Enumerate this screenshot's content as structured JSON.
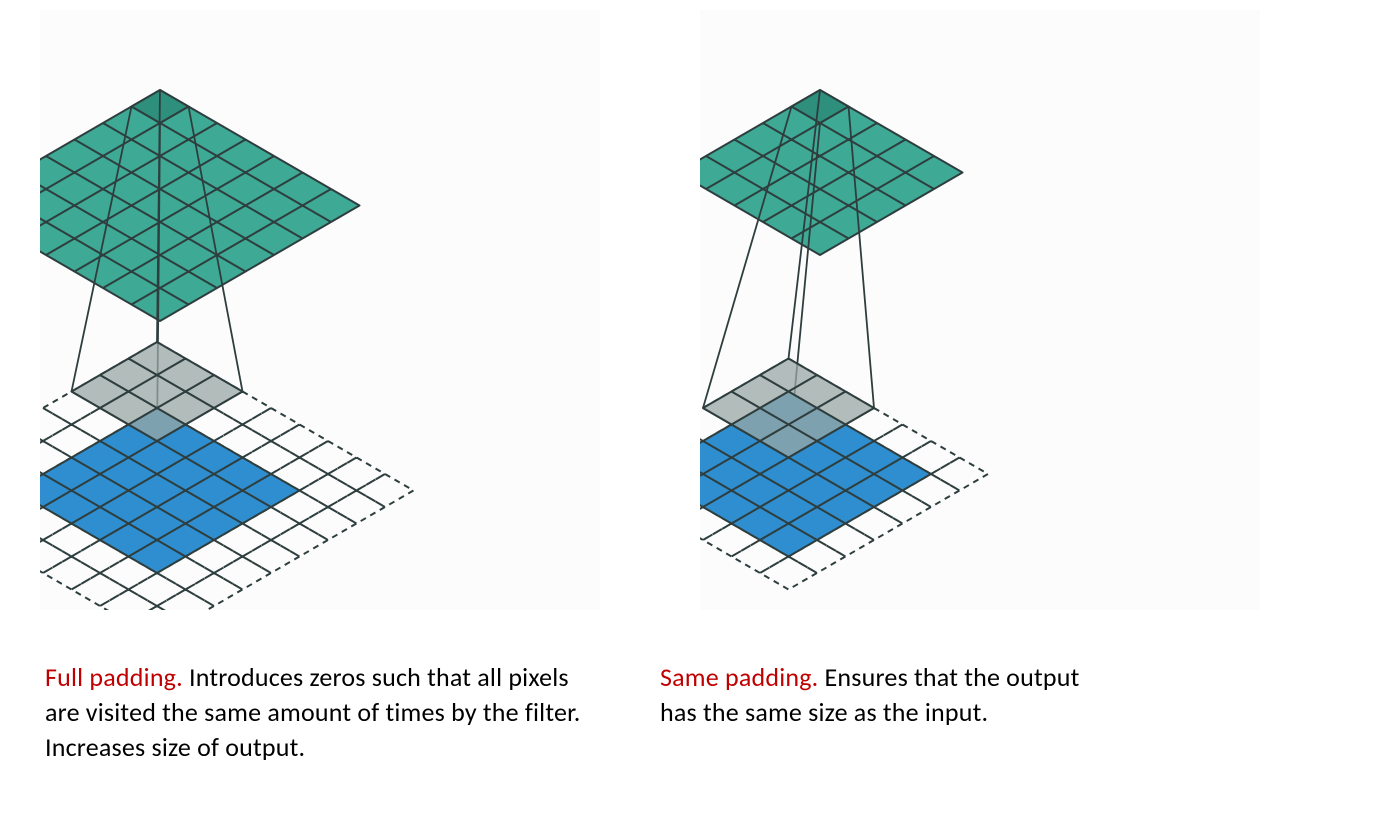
{
  "colors": {
    "teal": "#3ea995",
    "teal_dark": "#2d8f7c",
    "blue": "#2f8ecf",
    "kernel": "#9aa7a6",
    "stroke": "#2e3e3e",
    "accent_text": "#c00000"
  },
  "dims": {
    "full": {
      "input": 5,
      "kernel": 3,
      "pad": 2,
      "output": 7
    },
    "same": {
      "input": 5,
      "kernel": 3,
      "pad": 1,
      "output": 5
    }
  },
  "captions": {
    "full": {
      "term": "Full padding.",
      "text": " Introduces zeros such that all pixels are visited the same amount of times by the filter. Increases size of output."
    },
    "same": {
      "term": "Same padding.",
      "text": " Ensures that the output has the same size as the input."
    }
  }
}
